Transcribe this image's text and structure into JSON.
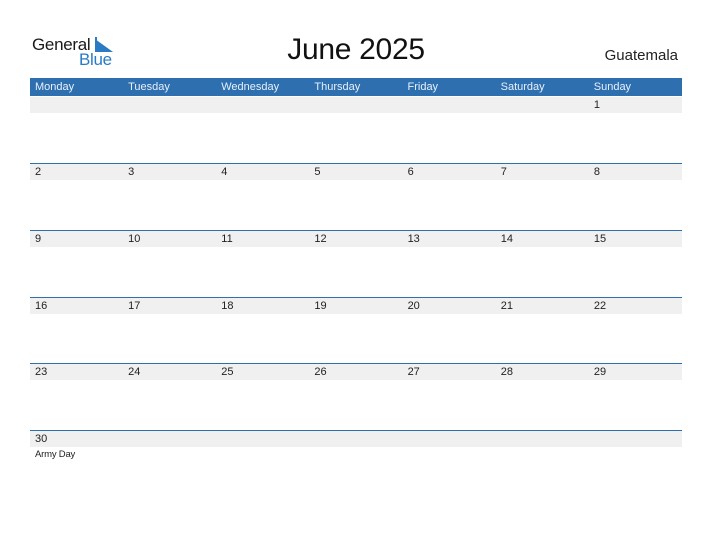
{
  "logo": {
    "line1": "General",
    "line2": "Blue"
  },
  "title": "June 2025",
  "country": "Guatemala",
  "colors": {
    "header": "#2e6fb0",
    "strip": "#f0f0f0",
    "brand_blue": "#2a7bc4"
  },
  "weekdays": [
    "Monday",
    "Tuesday",
    "Wednesday",
    "Thursday",
    "Friday",
    "Saturday",
    "Sunday"
  ],
  "weeks": [
    {
      "days": [
        "",
        "",
        "",
        "",
        "",
        "",
        "1"
      ],
      "events": [
        "",
        "",
        "",
        "",
        "",
        "",
        ""
      ]
    },
    {
      "days": [
        "2",
        "3",
        "4",
        "5",
        "6",
        "7",
        "8"
      ],
      "events": [
        "",
        "",
        "",
        "",
        "",
        "",
        ""
      ]
    },
    {
      "days": [
        "9",
        "10",
        "11",
        "12",
        "13",
        "14",
        "15"
      ],
      "events": [
        "",
        "",
        "",
        "",
        "",
        "",
        ""
      ]
    },
    {
      "days": [
        "16",
        "17",
        "18",
        "19",
        "20",
        "21",
        "22"
      ],
      "events": [
        "",
        "",
        "",
        "",
        "",
        "",
        ""
      ]
    },
    {
      "days": [
        "23",
        "24",
        "25",
        "26",
        "27",
        "28",
        "29"
      ],
      "events": [
        "",
        "",
        "",
        "",
        "",
        "",
        ""
      ]
    },
    {
      "days": [
        "30",
        "",
        "",
        "",
        "",
        "",
        ""
      ],
      "events": [
        "Army Day",
        "",
        "",
        "",
        "",
        "",
        ""
      ]
    }
  ]
}
